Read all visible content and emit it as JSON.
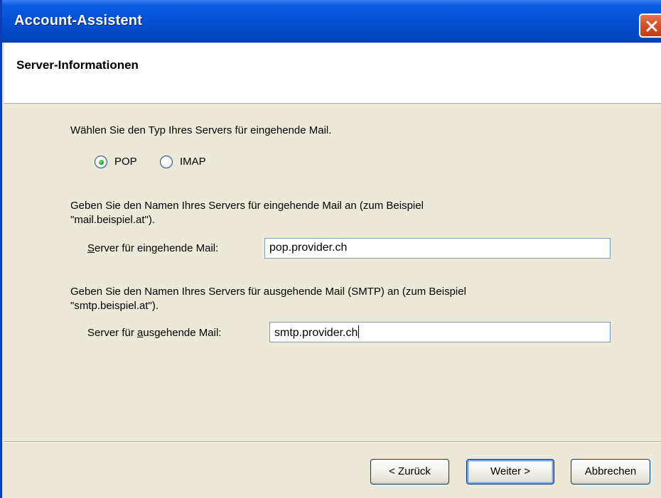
{
  "window": {
    "title": "Account-Assistent"
  },
  "header": {
    "title": "Server-Informationen"
  },
  "server_type": {
    "prompt": "Wählen Sie den Typ Ihres Servers für eingehende Mail.",
    "options": [
      {
        "label": "POP",
        "selected": true
      },
      {
        "label": "IMAP",
        "selected": false
      }
    ]
  },
  "incoming": {
    "description_line1": "Geben Sie den Namen Ihres Servers für eingehende Mail an (zum Beispiel",
    "description_line2": "\"mail.beispiel.at\").",
    "label_pre": "S",
    "label_rest": "erver für eingehende Mail:",
    "value": "pop.provider.ch"
  },
  "outgoing": {
    "description_line1": "Geben Sie den Namen Ihres Servers für ausgehende Mail (SMTP) an (zum Beispiel",
    "description_line2": "\"smtp.beispiel.at\").",
    "label_pre": "Server für ",
    "label_accel": "a",
    "label_rest": "usgehende Mail:",
    "value": "smtp.provider.ch"
  },
  "buttons": {
    "back": "< Zurück",
    "next": "Weiter >",
    "cancel": "Abbrechen"
  },
  "colors": {
    "titlebar": "#0552d6",
    "close": "#d8502a",
    "dialog_bg": "#ece9d8",
    "radio_selected": "#2aa52a"
  }
}
